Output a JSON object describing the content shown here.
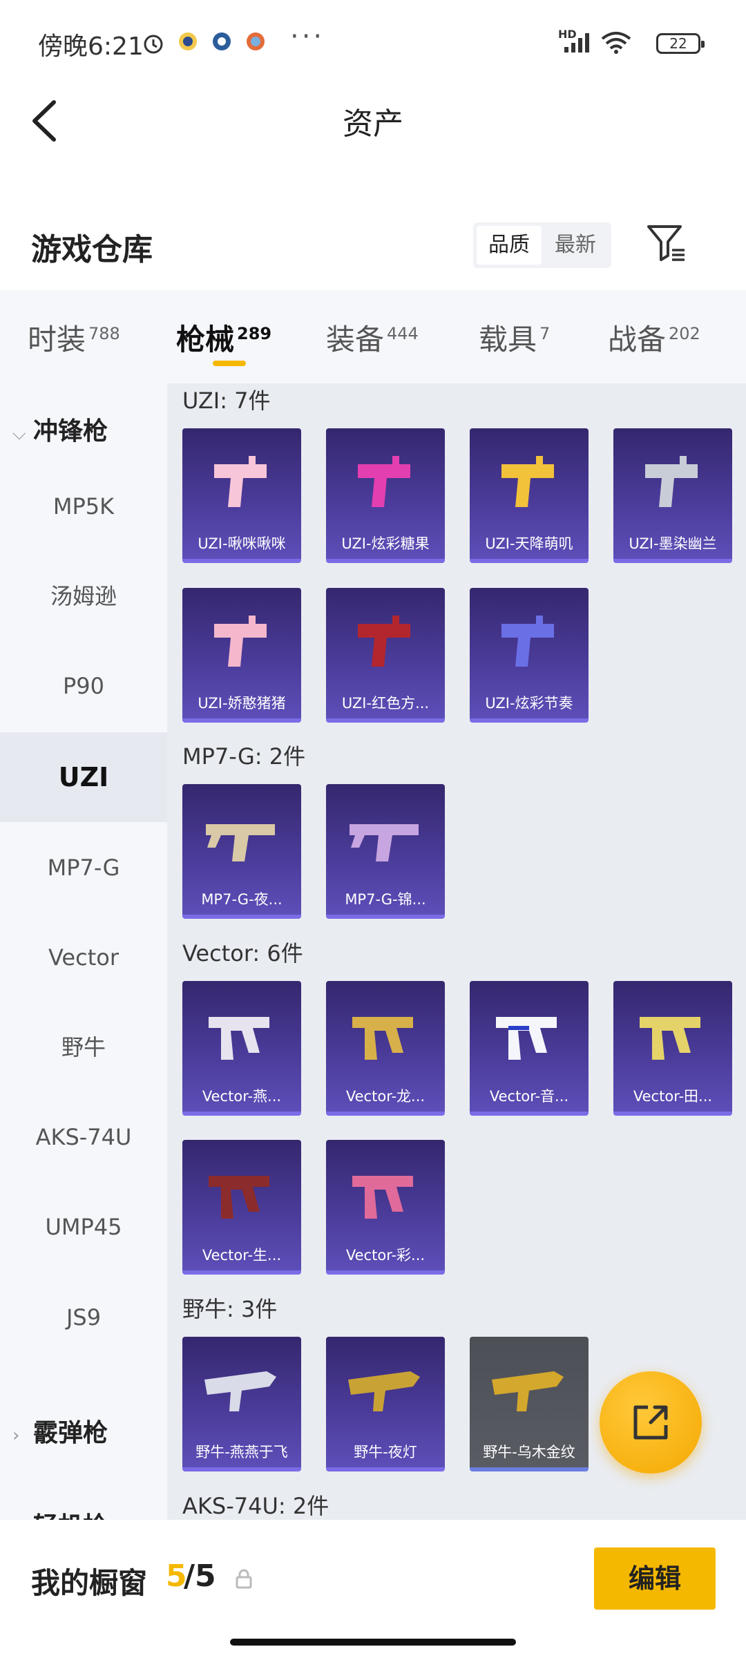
{
  "status": {
    "time": "傍晚6:21",
    "more": "···",
    "network": "HD",
    "battery": "22"
  },
  "header": {
    "title": "资产"
  },
  "warehouse": {
    "title": "游戏仓库",
    "sort_options": [
      "品质",
      "最新"
    ]
  },
  "tabs": [
    {
      "label": "时装",
      "count": "788"
    },
    {
      "label": "枪械",
      "count": "289"
    },
    {
      "label": "装备",
      "count": "444"
    },
    {
      "label": "载具",
      "count": "7"
    },
    {
      "label": "战备",
      "count": "202"
    }
  ],
  "sidebar": {
    "groups": [
      "冲锋枪",
      "霰弹枪",
      "轻机枪"
    ],
    "items": [
      "MP5K",
      "汤姆逊",
      "P90",
      "UZI",
      "MP7-G",
      "Vector",
      "野牛",
      "AKS-74U",
      "UMP45",
      "JS9"
    ]
  },
  "sections": [
    {
      "title": "UZI: 7件",
      "items": [
        "UZI-啾咪啾咪",
        "UZI-炫彩糖果",
        "UZI-天降萌叽",
        "UZI-墨染幽兰",
        "UZI-娇憨猪猪",
        "UZI-红色方...",
        "UZI-炫彩节奏"
      ]
    },
    {
      "title": "MP7-G: 2件",
      "items": [
        "MP7-G-夜...",
        "MP7-G-锦..."
      ]
    },
    {
      "title": "Vector: 6件",
      "items": [
        "Vector-燕...",
        "Vector-龙...",
        "Vector-音...",
        "Vector-田...",
        "Vector-生...",
        "Vector-彩..."
      ]
    },
    {
      "title": "野牛: 3件",
      "items": [
        "野牛-燕燕于飞",
        "野牛-夜灯",
        "野牛-乌木金纹"
      ]
    },
    {
      "title": "AKS-74U: 2件",
      "items": []
    }
  ],
  "bottom": {
    "label": "我的橱窗",
    "used": "5",
    "sep": "/",
    "total": "5",
    "edit": "编辑"
  },
  "colors": {
    "accent": "#f5b800",
    "card_bg": "#4a3b99"
  }
}
